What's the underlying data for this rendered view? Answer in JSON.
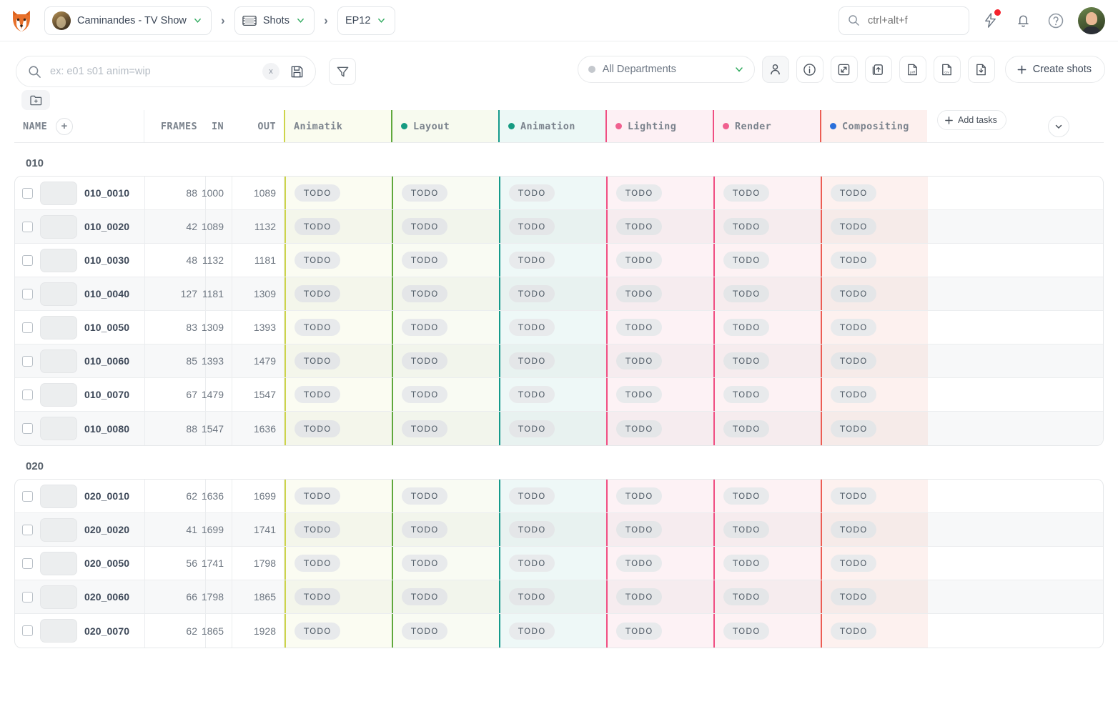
{
  "topbar": {
    "logo_icon": "fox-logo-icon",
    "breadcrumbs": [
      {
        "label": "Caminandes - TV Show",
        "icon": "project-avatar",
        "chevron": "chevron-down-icon"
      },
      {
        "label": "Shots",
        "icon": "shots-icon",
        "chevron": "chevron-down-icon"
      },
      {
        "label": "EP12",
        "icon": "",
        "chevron": "chevron-down-icon"
      }
    ],
    "separator": "›",
    "search": {
      "value": "ctrl+alt+f",
      "placeholder": "ctrl+alt+f",
      "icon": "search-icon"
    },
    "icons": [
      {
        "name": "bolt-icon",
        "badge": true
      },
      {
        "name": "bell-icon",
        "badge": false
      },
      {
        "name": "help-icon",
        "badge": false
      }
    ],
    "avatar": "user-avatar"
  },
  "toolbar": {
    "search": {
      "placeholder": "ex: e01 s01 anim=wip",
      "value": "",
      "clear_label": "x",
      "icon": "search-icon",
      "save_icon": "save-icon"
    },
    "filter_icon": "filter-icon",
    "folder_icon": "folder-add-icon",
    "department": {
      "label": "All Departments",
      "dot_color": "#c4c8cd",
      "chevron": "chevron-down-icon"
    },
    "action_icons": [
      {
        "name": "assignation-icon",
        "active": true
      },
      {
        "name": "info-icon",
        "active": false
      },
      {
        "name": "expand-icon",
        "active": false
      },
      {
        "name": "share-icon",
        "active": false
      },
      {
        "name": "export-pdf-icon",
        "active": false
      },
      {
        "name": "export-csv-icon",
        "active": false
      },
      {
        "name": "download-icon",
        "active": false
      }
    ],
    "create_button": {
      "label": "Create shots",
      "icon": "plus-icon"
    }
  },
  "table": {
    "columns": {
      "name": "NAME",
      "add_column_icon": "plus-circle-icon",
      "frames": "FRAMES",
      "in": "IN",
      "out": "OUT"
    },
    "tasks": [
      {
        "label": "Animatik",
        "dot": null,
        "border": "#cdd44a",
        "bg": "#fbfcf2",
        "bg_odd": "#f4f6eb",
        "header_bg": "#fafcef"
      },
      {
        "label": "Layout",
        "dot": "#169b82",
        "border": "#5fa83c",
        "bg": "#f9fbf3",
        "bg_odd": "#f2f5ec",
        "header_bg": "#f7faef"
      },
      {
        "label": "Animation",
        "dot": "#169b82",
        "border": "#159a8b",
        "bg": "#eef8f7",
        "bg_odd": "#e8f2f0",
        "header_bg": "#ecf8f6"
      },
      {
        "label": "Lighting",
        "dot": "#f0608f",
        "border": "#f04e82",
        "bg": "#fdf2f5",
        "bg_odd": "#f6ecef",
        "header_bg": "#fdf0f4"
      },
      {
        "label": "Render",
        "dot": "#f0608f",
        "border": "#f04e82",
        "bg": "#fdf2f4",
        "bg_odd": "#f6ecee",
        "header_bg": "#fdf0f3"
      },
      {
        "label": "Compositing",
        "dot": "#2a6fdb",
        "border": "#ec5d53",
        "bg": "#fdf1ef",
        "bg_odd": "#f6ebe9",
        "header_bg": "#fdf0ee"
      }
    ],
    "add_tasks_button": {
      "label": "Add tasks",
      "icon": "plus-icon"
    },
    "collapse_icon": "chevron-down-icon",
    "status_label": "TODO",
    "sequences": [
      {
        "name": "010",
        "rows": [
          {
            "name": "010_0010",
            "frames": "88",
            "in": "1000",
            "out": "1089"
          },
          {
            "name": "010_0020",
            "frames": "42",
            "in": "1089",
            "out": "1132"
          },
          {
            "name": "010_0030",
            "frames": "48",
            "in": "1132",
            "out": "1181"
          },
          {
            "name": "010_0040",
            "frames": "127",
            "in": "1181",
            "out": "1309"
          },
          {
            "name": "010_0050",
            "frames": "83",
            "in": "1309",
            "out": "1393"
          },
          {
            "name": "010_0060",
            "frames": "85",
            "in": "1393",
            "out": "1479"
          },
          {
            "name": "010_0070",
            "frames": "67",
            "in": "1479",
            "out": "1547"
          },
          {
            "name": "010_0080",
            "frames": "88",
            "in": "1547",
            "out": "1636"
          }
        ]
      },
      {
        "name": "020",
        "rows": [
          {
            "name": "020_0010",
            "frames": "62",
            "in": "1636",
            "out": "1699"
          },
          {
            "name": "020_0020",
            "frames": "41",
            "in": "1699",
            "out": "1741"
          },
          {
            "name": "020_0050",
            "frames": "56",
            "in": "1741",
            "out": "1798"
          },
          {
            "name": "020_0060",
            "frames": "66",
            "in": "1798",
            "out": "1865"
          },
          {
            "name": "020_0070",
            "frames": "62",
            "in": "1865",
            "out": "1928"
          }
        ]
      }
    ]
  }
}
